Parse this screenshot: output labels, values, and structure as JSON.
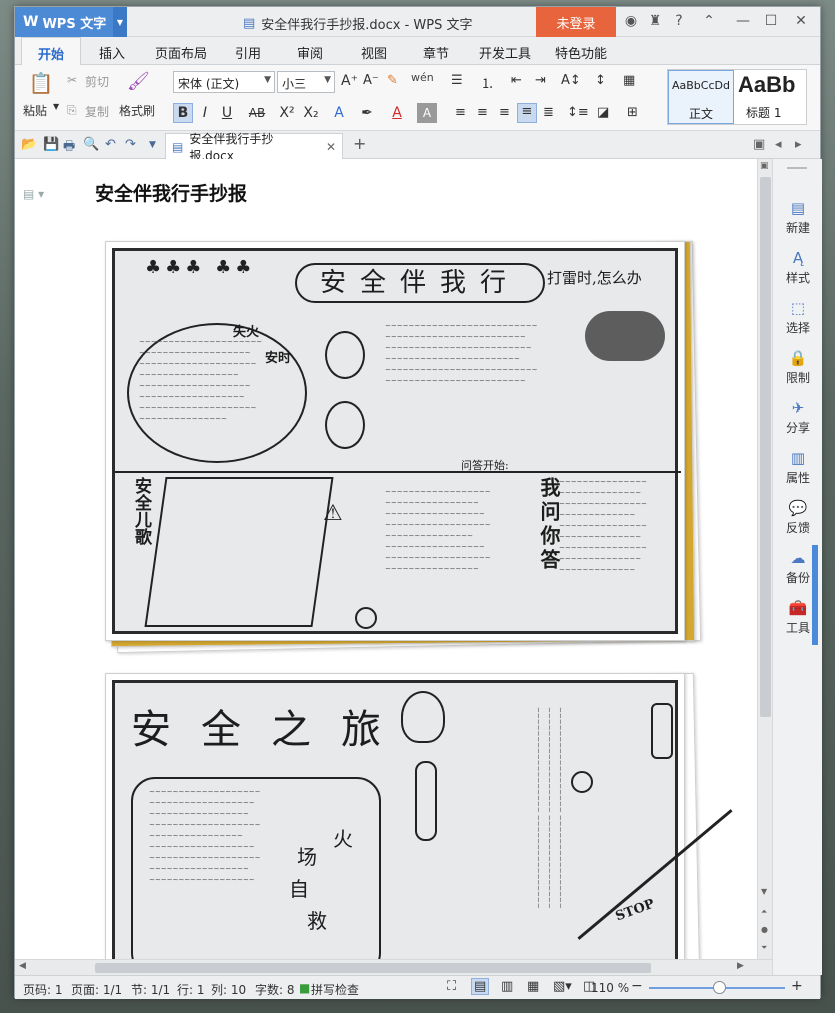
{
  "app": {
    "brand": "WPS 文字",
    "window_title": "安全伴我行手抄报.docx - WPS 文字",
    "login_label": "未登录",
    "help_label": "?"
  },
  "menu": [
    "开始",
    "插入",
    "页面布局",
    "引用",
    "审阅",
    "视图",
    "章节",
    "开发工具",
    "特色功能"
  ],
  "ribbon": {
    "paste": "粘贴",
    "cut": "剪切",
    "copy": "复制",
    "format_painter": "格式刷",
    "font_name": "宋体 (正文)",
    "font_size": "小三",
    "style_normal_preview": "AaBbCcDd",
    "style_normal": "正文",
    "style_heading_preview": "AaBb",
    "style_heading": "标题 1"
  },
  "doc_tab": {
    "label": "安全伴我行手抄报.docx"
  },
  "document": {
    "heading": "安全伴我行手抄报",
    "poster1": {
      "title": "安全伴我行",
      "corner_title": "打雷时,怎么办",
      "song": "安全儿歌",
      "qa": "我问你答",
      "fire": "失火",
      "when": "安时",
      "qa_head": "问答开始:"
    },
    "poster2": {
      "title": "安全之旅",
      "fire": "火",
      "field": "场",
      "self": "自",
      "rescue": "救",
      "stop": "STOP"
    }
  },
  "side_panel": [
    "新建",
    "样式",
    "选择",
    "限制",
    "分享",
    "属性",
    "反馈",
    "备份",
    "工具"
  ],
  "status": {
    "page": "页码: 1",
    "pages": "页面: 1/1",
    "section": "节: 1/1",
    "row": "行: 1",
    "col": "列: 10",
    "words": "字数: 8",
    "spell": "拼写检查",
    "zoom": "110 %"
  }
}
